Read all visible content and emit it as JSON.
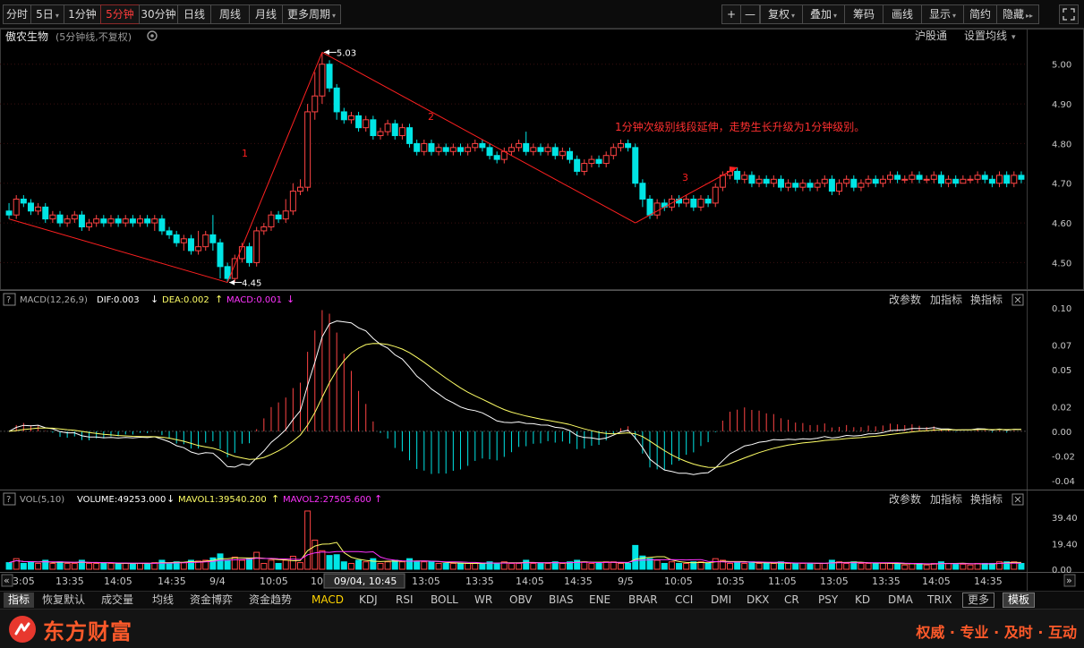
{
  "toolbar": {
    "left": [
      {
        "label": "分时",
        "active": false,
        "dropdown": false
      },
      {
        "label": "5日",
        "active": false,
        "dropdown": true
      },
      {
        "label": "1分钟",
        "active": false,
        "dropdown": false
      },
      {
        "label": "5分钟",
        "active": true,
        "dropdown": false
      },
      {
        "label": "30分钟",
        "active": false,
        "dropdown": false
      },
      {
        "label": "日线",
        "active": false,
        "dropdown": false
      },
      {
        "label": "周线",
        "active": false,
        "dropdown": false
      },
      {
        "label": "月线",
        "active": false,
        "dropdown": false
      },
      {
        "label": "更多周期",
        "active": false,
        "dropdown": true
      }
    ],
    "zoom_in": "+",
    "zoom_out": "—",
    "right": [
      {
        "label": "复权",
        "dropdown": true
      },
      {
        "label": "叠加",
        "dropdown": true
      },
      {
        "label": "筹码",
        "dropdown": false
      },
      {
        "label": "画线",
        "dropdown": false
      },
      {
        "label": "显示",
        "dropdown": true
      },
      {
        "label": "简约",
        "dropdown": false
      },
      {
        "label": "隐藏",
        "dropdown": false,
        "suffix": "▸▸"
      }
    ],
    "fullscreen_icon": "expand-icon"
  },
  "price_panel": {
    "stock_name": "傲农生物",
    "subtitle": "(5分钟线,不复权)",
    "links": [
      "沪股通",
      "设置均线"
    ],
    "peak_label": "5.03",
    "low_label": "4.45",
    "annotation": "1分钟次级别线段延伸，走势生长升级为1分钟级别。",
    "leg_labels": [
      "1",
      "2",
      "3"
    ],
    "y_ticks": [
      "5.00",
      "4.90",
      "4.80",
      "4.70",
      "4.60",
      "4.50"
    ]
  },
  "macd_panel": {
    "name": "MACD(12,26,9)",
    "dif": "DIF:0.003",
    "dif_arrow": "↓",
    "dea": "DEA:0.002",
    "dea_arrow": "↑",
    "macd": "MACD:0.001",
    "macd_arrow": "↓",
    "buttons": [
      "改参数",
      "加指标",
      "换指标"
    ],
    "y_ticks": [
      "0.10",
      "0.07",
      "0.05",
      "0.02",
      "0.00",
      "-0.02",
      "-0.04"
    ]
  },
  "vol_panel": {
    "name": "VOL(5,10)",
    "volume": "VOLUME:49253.000",
    "volume_arrow": "↓",
    "mavol1": "MAVOL1:39540.200",
    "mavol1_arrow": "↑",
    "mavol2": "MAVOL2:27505.600",
    "mavol2_arrow": "↑",
    "buttons": [
      "改参数",
      "加指标",
      "换指标"
    ],
    "y_ticks": [
      "39.40",
      "19.40",
      "0.00"
    ]
  },
  "time_axis": {
    "labels": [
      "3:05",
      "13:35",
      "14:05",
      "14:35",
      "9/4",
      "10:05",
      "10",
      "13:05",
      "13:35",
      "14:05",
      "14:35",
      "9/5",
      "10:05",
      "10:35",
      "11:05",
      "13:05",
      "13:35",
      "14:05",
      "14:35"
    ],
    "cursor_time": "09/04, 10:45"
  },
  "indicator_bar": {
    "items": [
      "指标",
      "恢复默认",
      "成交量",
      "均线",
      "资金博弈",
      "资金趋势",
      "MACD",
      "KDJ",
      "RSI",
      "BOLL",
      "WR",
      "OBV",
      "BIAS",
      "ENE",
      "BRAR",
      "CCI",
      "DMI",
      "DKX",
      "CR",
      "PSY",
      "KD",
      "DMA",
      "TRIX",
      "更多",
      "模板"
    ]
  },
  "footer": {
    "brand": "东方财富",
    "slogan": "权威 · 专业 · 及时 · 互动"
  },
  "colors": {
    "up": "#ff4444",
    "down": "#00e5e5",
    "dif": "#ffffff",
    "dea": "#ffff66",
    "macd_label": "#ff33ff",
    "trend": "#ff2020"
  },
  "chart_data": {
    "type": "candlestick",
    "period": "5分钟",
    "price_ylim": [
      4.44,
      5.04
    ],
    "macd_ylim": [
      -0.045,
      0.1
    ],
    "candles": [
      [
        4.63,
        4.62,
        4.65,
        4.61
      ],
      [
        4.62,
        4.66,
        4.67,
        4.61
      ],
      [
        4.66,
        4.65,
        4.67,
        4.64
      ],
      [
        4.65,
        4.63,
        4.66,
        4.62
      ],
      [
        4.63,
        4.64,
        4.65,
        4.62
      ],
      [
        4.64,
        4.61,
        4.65,
        4.6
      ],
      [
        4.61,
        4.62,
        4.63,
        4.6
      ],
      [
        4.62,
        4.6,
        4.63,
        4.59
      ],
      [
        4.6,
        4.61,
        4.62,
        4.59
      ],
      [
        4.61,
        4.62,
        4.63,
        4.6
      ],
      [
        4.62,
        4.59,
        4.63,
        4.58
      ],
      [
        4.59,
        4.6,
        4.61,
        4.58
      ],
      [
        4.6,
        4.61,
        4.62,
        4.59
      ],
      [
        4.61,
        4.6,
        4.62,
        4.59
      ],
      [
        4.6,
        4.61,
        4.62,
        4.59
      ],
      [
        4.61,
        4.6,
        4.62,
        4.59
      ],
      [
        4.6,
        4.61,
        4.62,
        4.59
      ],
      [
        4.61,
        4.6,
        4.62,
        4.59
      ],
      [
        4.6,
        4.61,
        4.62,
        4.59
      ],
      [
        4.61,
        4.6,
        4.62,
        4.59
      ],
      [
        4.6,
        4.61,
        4.62,
        4.58
      ],
      [
        4.61,
        4.58,
        4.62,
        4.57
      ],
      [
        4.58,
        4.57,
        4.59,
        4.56
      ],
      [
        4.57,
        4.55,
        4.58,
        4.54
      ],
      [
        4.55,
        4.56,
        4.57,
        4.53
      ],
      [
        4.56,
        4.53,
        4.57,
        4.52
      ],
      [
        4.53,
        4.54,
        4.58,
        4.52
      ],
      [
        4.54,
        4.57,
        4.58,
        4.53
      ],
      [
        4.57,
        4.55,
        4.62,
        4.53
      ],
      [
        4.55,
        4.49,
        4.56,
        4.46
      ],
      [
        4.49,
        4.46,
        4.5,
        4.45
      ],
      [
        4.46,
        4.51,
        4.52,
        4.45
      ],
      [
        4.51,
        4.54,
        4.55,
        4.5
      ],
      [
        4.54,
        4.5,
        4.55,
        4.49
      ],
      [
        4.5,
        4.58,
        4.59,
        4.49
      ],
      [
        4.58,
        4.59,
        4.6,
        4.57
      ],
      [
        4.59,
        4.62,
        4.63,
        4.58
      ],
      [
        4.62,
        4.61,
        4.63,
        4.6
      ],
      [
        4.61,
        4.63,
        4.66,
        4.6
      ],
      [
        4.63,
        4.68,
        4.7,
        4.62
      ],
      [
        4.68,
        4.69,
        4.71,
        4.67
      ],
      [
        4.69,
        4.88,
        4.9,
        4.68
      ],
      [
        4.88,
        4.92,
        4.98,
        4.86
      ],
      [
        4.92,
        5.0,
        5.03,
        4.9
      ],
      [
        5.0,
        4.94,
        5.01,
        4.93
      ],
      [
        4.94,
        4.88,
        4.95,
        4.86
      ],
      [
        4.88,
        4.86,
        4.89,
        4.85
      ],
      [
        4.86,
        4.87,
        4.88,
        4.85
      ],
      [
        4.87,
        4.84,
        4.88,
        4.83
      ],
      [
        4.84,
        4.86,
        4.87,
        4.83
      ],
      [
        4.86,
        4.82,
        4.87,
        4.81
      ],
      [
        4.82,
        4.83,
        4.84,
        4.81
      ],
      [
        4.83,
        4.85,
        4.86,
        4.82
      ],
      [
        4.85,
        4.82,
        4.86,
        4.81
      ],
      [
        4.82,
        4.84,
        4.85,
        4.81
      ],
      [
        4.84,
        4.8,
        4.85,
        4.79
      ],
      [
        4.8,
        4.78,
        4.81,
        4.77
      ],
      [
        4.78,
        4.8,
        4.81,
        4.77
      ],
      [
        4.8,
        4.78,
        4.81,
        4.77
      ],
      [
        4.78,
        4.79,
        4.8,
        4.77
      ],
      [
        4.79,
        4.78,
        4.8,
        4.77
      ],
      [
        4.78,
        4.79,
        4.8,
        4.77
      ],
      [
        4.79,
        4.78,
        4.8,
        4.77
      ],
      [
        4.78,
        4.79,
        4.8,
        4.77
      ],
      [
        4.79,
        4.8,
        4.81,
        4.78
      ],
      [
        4.8,
        4.79,
        4.81,
        4.78
      ],
      [
        4.79,
        4.77,
        4.8,
        4.76
      ],
      [
        4.77,
        4.76,
        4.78,
        4.75
      ],
      [
        4.76,
        4.78,
        4.79,
        4.75
      ],
      [
        4.78,
        4.79,
        4.8,
        4.77
      ],
      [
        4.79,
        4.8,
        4.81,
        4.78
      ],
      [
        4.8,
        4.78,
        4.83,
        4.77
      ],
      [
        4.78,
        4.79,
        4.8,
        4.77
      ],
      [
        4.79,
        4.78,
        4.8,
        4.77
      ],
      [
        4.78,
        4.79,
        4.8,
        4.77
      ],
      [
        4.79,
        4.77,
        4.8,
        4.76
      ],
      [
        4.77,
        4.78,
        4.79,
        4.76
      ],
      [
        4.78,
        4.76,
        4.79,
        4.75
      ],
      [
        4.76,
        4.73,
        4.77,
        4.72
      ],
      [
        4.73,
        4.75,
        4.76,
        4.72
      ],
      [
        4.75,
        4.76,
        4.77,
        4.74
      ],
      [
        4.76,
        4.75,
        4.77,
        4.74
      ],
      [
        4.75,
        4.77,
        4.78,
        4.74
      ],
      [
        4.77,
        4.79,
        4.8,
        4.76
      ],
      [
        4.79,
        4.8,
        4.81,
        4.78
      ],
      [
        4.8,
        4.79,
        4.81,
        4.78
      ],
      [
        4.79,
        4.7,
        4.8,
        4.69
      ],
      [
        4.7,
        4.66,
        4.71,
        4.64
      ],
      [
        4.66,
        4.62,
        4.67,
        4.61
      ],
      [
        4.62,
        4.65,
        4.66,
        4.61
      ],
      [
        4.65,
        4.64,
        4.66,
        4.63
      ],
      [
        4.64,
        4.66,
        4.67,
        4.63
      ],
      [
        4.66,
        4.65,
        4.67,
        4.64
      ],
      [
        4.65,
        4.66,
        4.67,
        4.64
      ],
      [
        4.66,
        4.64,
        4.67,
        4.63
      ],
      [
        4.64,
        4.66,
        4.67,
        4.63
      ],
      [
        4.66,
        4.65,
        4.67,
        4.64
      ],
      [
        4.65,
        4.69,
        4.7,
        4.64
      ],
      [
        4.69,
        4.72,
        4.73,
        4.68
      ],
      [
        4.72,
        4.73,
        4.74,
        4.71
      ],
      [
        4.73,
        4.71,
        4.74,
        4.7
      ],
      [
        4.71,
        4.72,
        4.73,
        4.7
      ],
      [
        4.72,
        4.7,
        4.73,
        4.69
      ],
      [
        4.7,
        4.71,
        4.72,
        4.69
      ],
      [
        4.71,
        4.7,
        4.72,
        4.69
      ],
      [
        4.7,
        4.71,
        4.72,
        4.69
      ],
      [
        4.71,
        4.69,
        4.72,
        4.68
      ],
      [
        4.69,
        4.7,
        4.71,
        4.68
      ],
      [
        4.7,
        4.69,
        4.71,
        4.68
      ],
      [
        4.69,
        4.7,
        4.71,
        4.68
      ],
      [
        4.7,
        4.69,
        4.71,
        4.68
      ],
      [
        4.69,
        4.7,
        4.71,
        4.68
      ],
      [
        4.7,
        4.71,
        4.72,
        4.69
      ],
      [
        4.71,
        4.68,
        4.72,
        4.67
      ],
      [
        4.68,
        4.7,
        4.71,
        4.67
      ],
      [
        4.7,
        4.71,
        4.72,
        4.69
      ],
      [
        4.71,
        4.69,
        4.72,
        4.68
      ],
      [
        4.69,
        4.7,
        4.71,
        4.68
      ],
      [
        4.7,
        4.71,
        4.72,
        4.69
      ],
      [
        4.71,
        4.7,
        4.72,
        4.69
      ],
      [
        4.7,
        4.71,
        4.72,
        4.69
      ],
      [
        4.71,
        4.72,
        4.73,
        4.7
      ],
      [
        4.72,
        4.71,
        4.73,
        4.7
      ],
      [
        4.71,
        4.71,
        4.72,
        4.7
      ],
      [
        4.71,
        4.72,
        4.73,
        4.7
      ],
      [
        4.72,
        4.71,
        4.73,
        4.7
      ],
      [
        4.71,
        4.71,
        4.72,
        4.7
      ],
      [
        4.71,
        4.72,
        4.73,
        4.7
      ],
      [
        4.72,
        4.7,
        4.73,
        4.69
      ],
      [
        4.7,
        4.71,
        4.72,
        4.69
      ],
      [
        4.71,
        4.7,
        4.72,
        4.69
      ],
      [
        4.7,
        4.71,
        4.72,
        4.7
      ],
      [
        4.71,
        4.71,
        4.72,
        4.7
      ],
      [
        4.71,
        4.72,
        4.73,
        4.7
      ],
      [
        4.72,
        4.71,
        4.73,
        4.7
      ],
      [
        4.71,
        4.7,
        4.72,
        4.69
      ],
      [
        4.7,
        4.72,
        4.73,
        4.69
      ],
      [
        4.72,
        4.7,
        4.73,
        4.69
      ],
      [
        4.7,
        4.72,
        4.73,
        4.69
      ],
      [
        4.72,
        4.71,
        4.73,
        4.7
      ]
    ],
    "trend_points": [
      [
        0,
        4.61
      ],
      [
        30,
        4.45
      ],
      [
        43,
        5.03
      ],
      [
        86,
        4.6
      ],
      [
        100,
        4.74
      ]
    ],
    "volume_max_label": 39.4
  }
}
